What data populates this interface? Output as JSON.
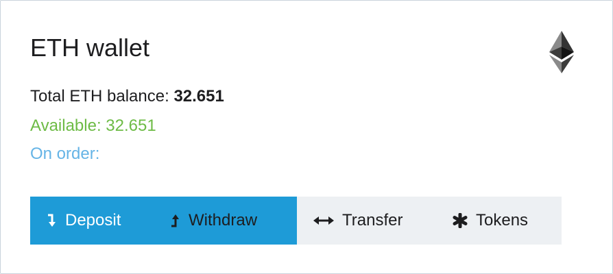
{
  "wallet": {
    "title": "ETH wallet",
    "logo_icon": "ethereum-icon",
    "total_label": "Total ETH balance: ",
    "total_value": "32.651",
    "available_text": "Available: 32.651",
    "on_order_text": "On order:"
  },
  "actions": {
    "deposit_label": "Deposit",
    "withdraw_label": "Withdraw",
    "transfer_label": "Transfer",
    "tokens_label": "Tokens"
  },
  "colors": {
    "primary": "#1e9bd7",
    "secondary_bg": "#edf0f3",
    "available": "#6dbb45",
    "on_order": "#65b4e6",
    "border": "#c9d3db"
  }
}
